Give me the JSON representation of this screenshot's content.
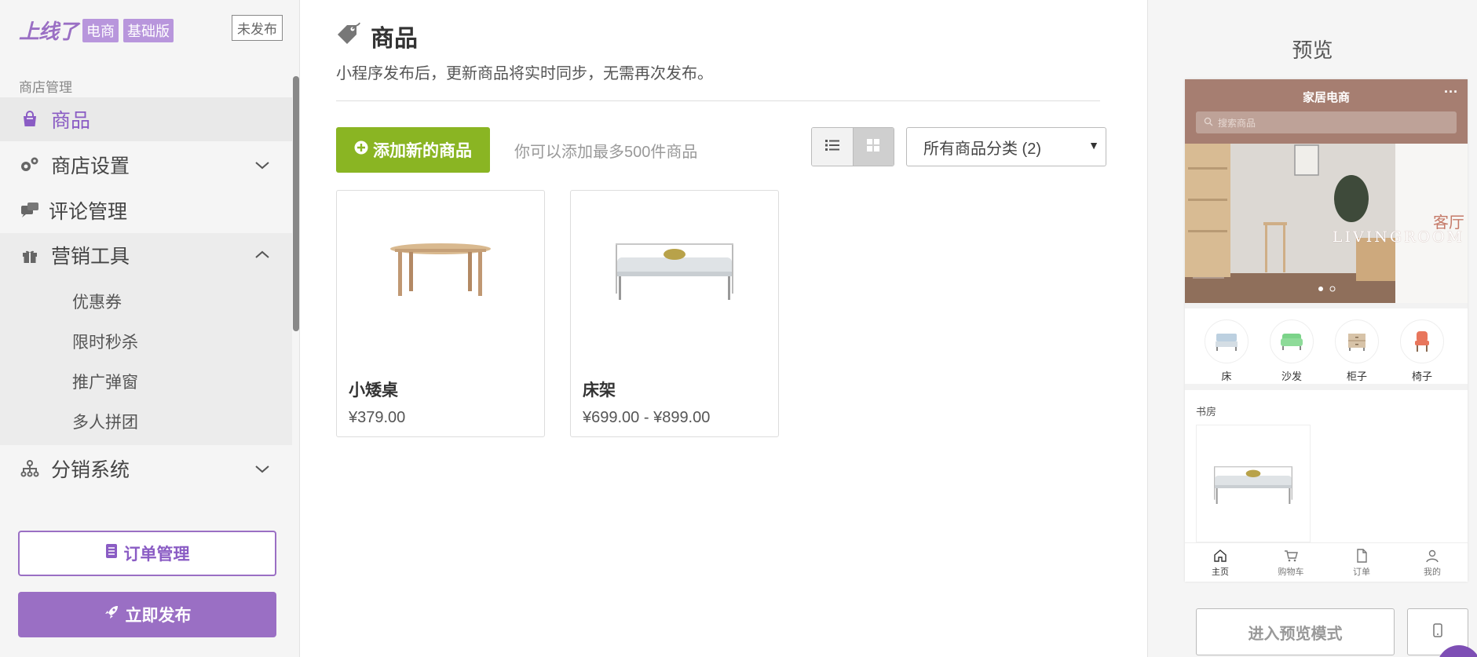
{
  "brand": {
    "logo_text": "上线了",
    "badge_ecommerce": "电商",
    "badge_basic": "基础版",
    "unpublished": "未发布"
  },
  "sidebar": {
    "section_label": "商店管理",
    "items": [
      {
        "label": "商品",
        "icon": "shopping-bag-icon",
        "active": true
      },
      {
        "label": "商店设置",
        "icon": "gears-icon"
      },
      {
        "label": "评论管理",
        "icon": "comments-icon"
      },
      {
        "label": "营销工具",
        "icon": "gift-icon",
        "expanded": true
      },
      {
        "label": "分销系统",
        "icon": "sitemap-icon"
      }
    ],
    "marketing_sub": [
      "优惠券",
      "限时秒杀",
      "推广弹窗",
      "多人拼团"
    ],
    "orders_button": "订单管理",
    "publish_button": "立即发布"
  },
  "main": {
    "title": "商品",
    "subtitle": "小程序发布后，更新商品将实时同步，无需再次发布。",
    "add_button": "添加新的商品",
    "limit_text": "你可以添加最多500件商品",
    "category_select": "所有商品分类 (2)",
    "products": [
      {
        "name": "小矮桌",
        "price": "¥379.00"
      },
      {
        "name": "床架",
        "price": "¥699.00 - ¥899.00"
      }
    ]
  },
  "preview": {
    "title": "预览",
    "phone": {
      "store_name": "家居电商",
      "more": "···",
      "search_placeholder": "搜索商品",
      "banner_cn": "客厅",
      "banner_en": "LIVINGROOM",
      "categories": [
        "床",
        "沙发",
        "柜子",
        "椅子"
      ],
      "section": "书房",
      "tabs": [
        "主页",
        "购物车",
        "订单",
        "我的"
      ]
    },
    "enter_button": "进入预览模式"
  },
  "colors": {
    "accent": "#9a6fc4",
    "add_green": "#8ab523",
    "header_brown": "#a67e71"
  }
}
